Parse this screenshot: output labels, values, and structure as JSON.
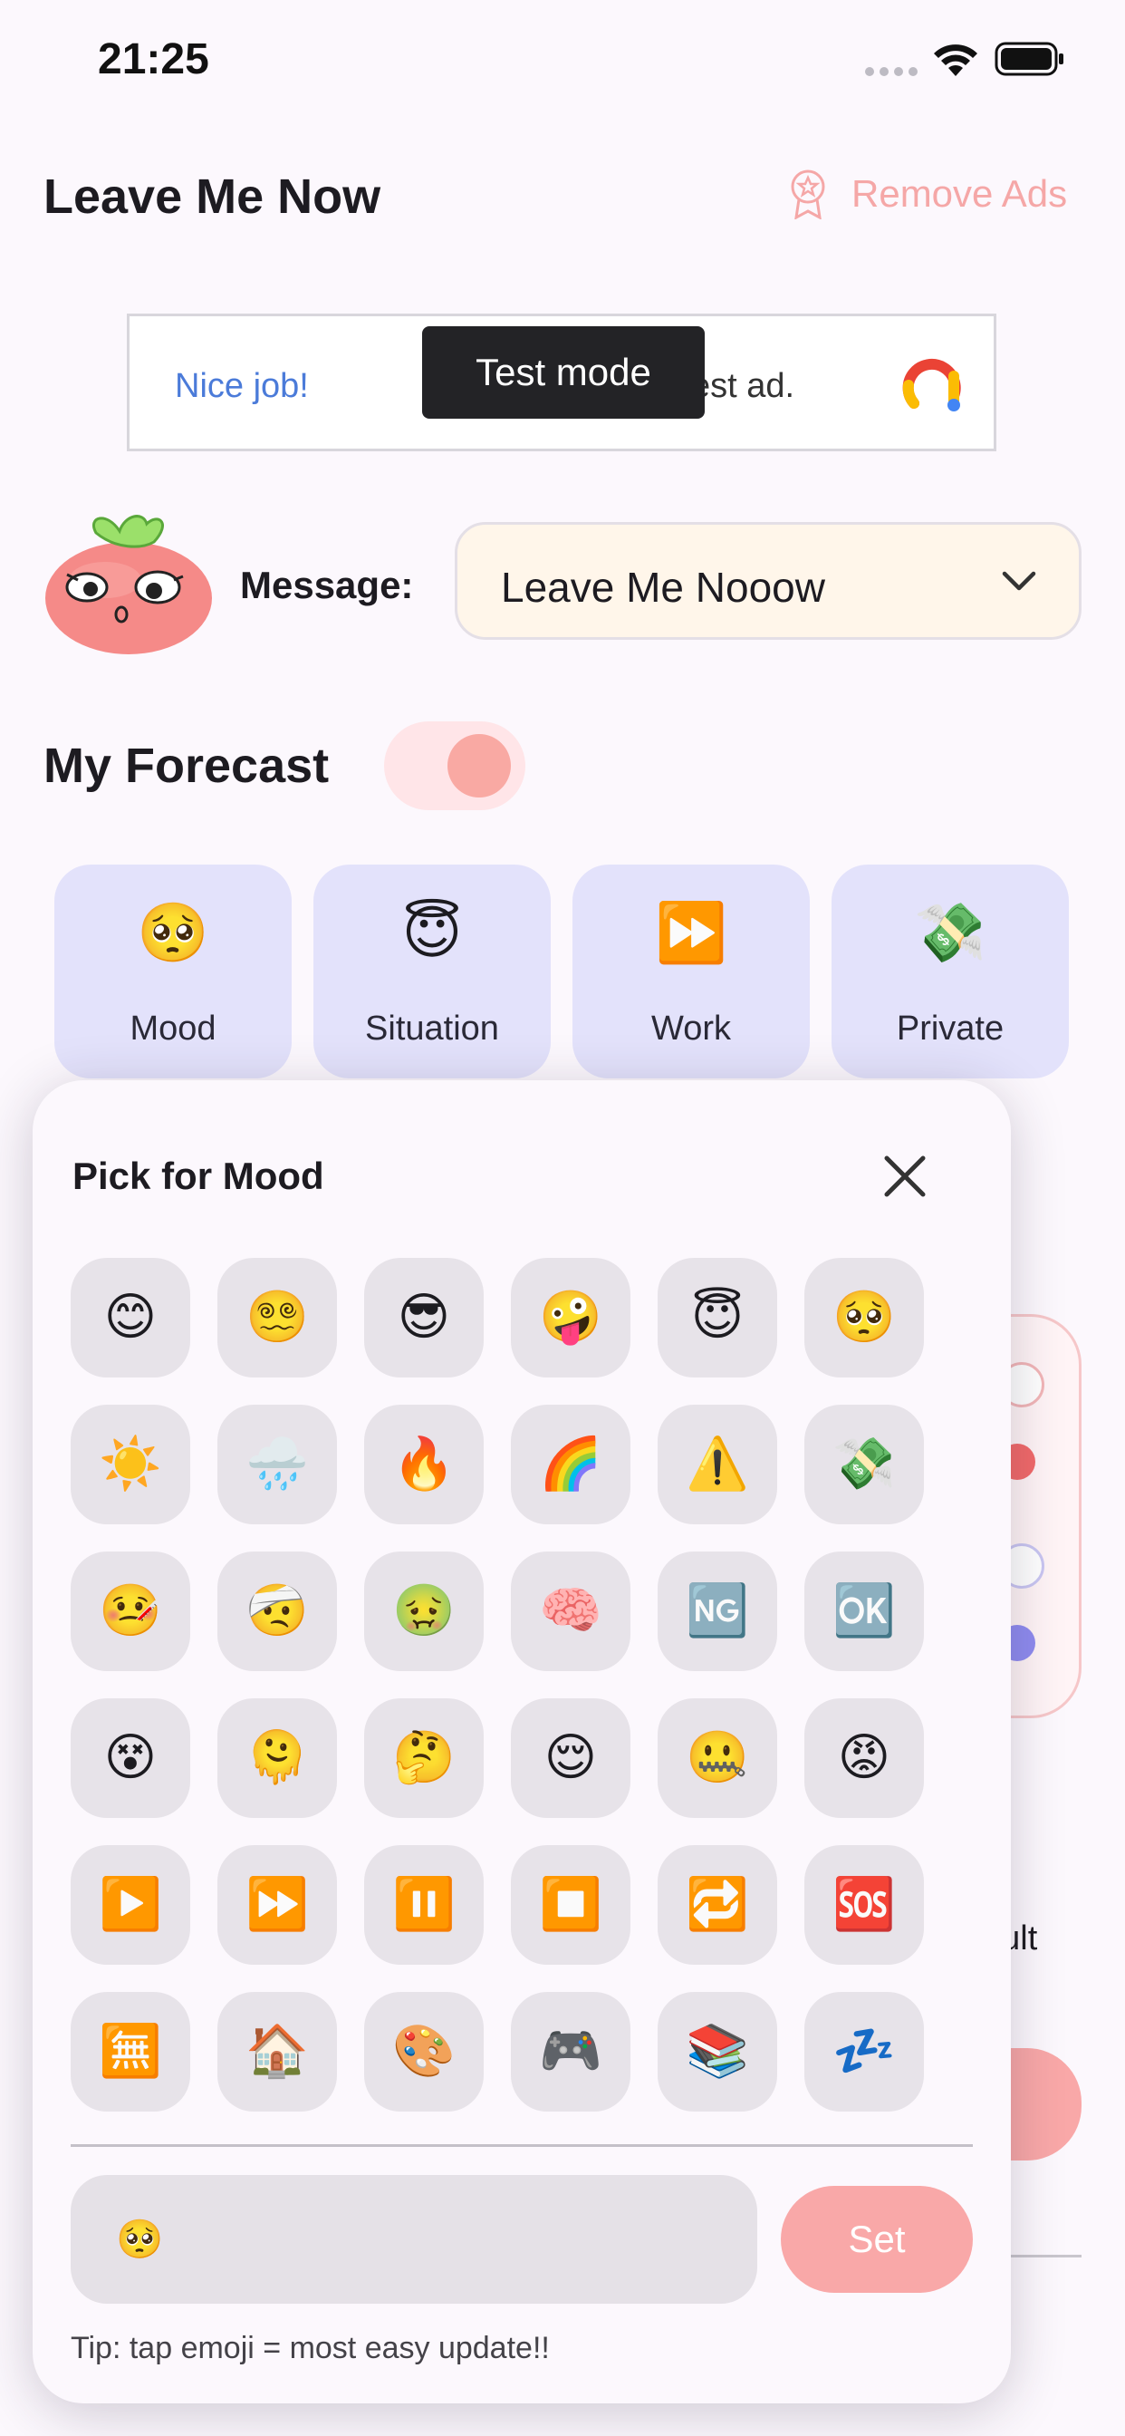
{
  "status_bar": {
    "time": "21:25"
  },
  "header": {
    "title": "Leave Me Now",
    "remove_ads_label": "Remove Ads"
  },
  "ad": {
    "left_text": "Nice job!",
    "right_text": "est ad.",
    "test_mode_label": "Test mode"
  },
  "message": {
    "label": "Message:",
    "selected": "Leave Me Nooow"
  },
  "forecast": {
    "title": "My Forecast",
    "toggle_on": true,
    "categories": [
      {
        "emoji": "🥺",
        "label": "Mood",
        "icon": "pleading-face-icon"
      },
      {
        "emoji": "😇",
        "label": "Situation",
        "icon": "halo-face-icon"
      },
      {
        "emoji": "⏩",
        "label": "Work",
        "icon": "fast-forward-icon"
      },
      {
        "emoji": "💸",
        "label": "Private",
        "icon": "money-wings-icon"
      }
    ]
  },
  "background": {
    "partial_label": "ault"
  },
  "picker": {
    "title": "Pick for Mood",
    "emojis": [
      "😊",
      "😵‍💫",
      "😎",
      "🤪",
      "😇",
      "🥺",
      "☀️",
      "🌧️",
      "🔥",
      "🌈",
      "⚠️",
      "💸",
      "🤒",
      "🤕",
      "🤢",
      "🧠",
      "🆖",
      "🆗",
      "😵",
      "🫠",
      "🤔",
      "😌",
      "🤐",
      "😡",
      "▶️",
      "⏩",
      "⏸️",
      "⏹️",
      "🔁",
      "🆘",
      "🈚",
      "🏠",
      "🎨",
      "🎮",
      "📚",
      "💤"
    ],
    "input_value": "🥺",
    "set_label": "Set",
    "tip": "Tip: tap emoji = most easy update!!"
  },
  "colors": {
    "accent": "#f9a8a8",
    "card_bg": "#e3e2fb",
    "select_bg": "#fff6ea",
    "remove_ads": "#f5a7a7"
  }
}
